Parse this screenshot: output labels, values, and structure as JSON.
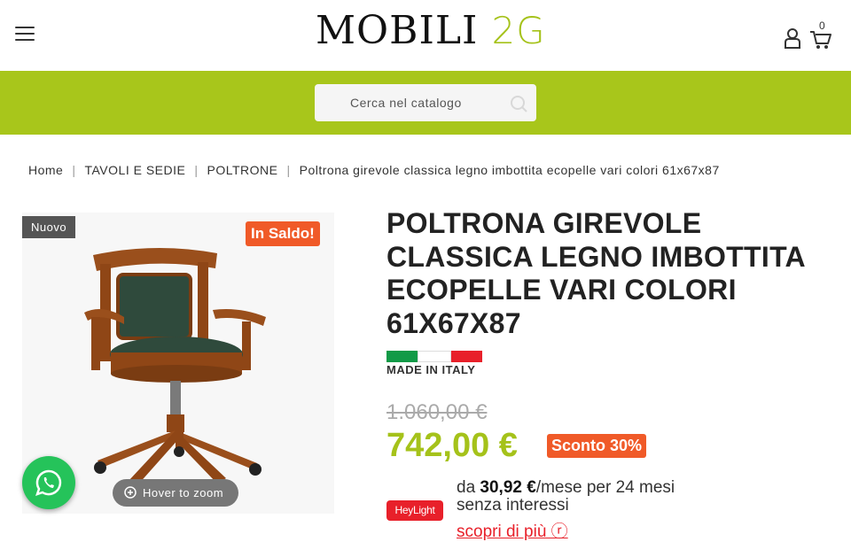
{
  "header": {
    "logo_text_1": "MOBILI ",
    "logo_text_2": "2G",
    "cart_count": "0",
    "icons": [
      "menu-icon",
      "user-icon",
      "cart-icon"
    ]
  },
  "search": {
    "placeholder": "Cerca nel catalogo"
  },
  "breadcrumb": {
    "items": [
      "Home",
      "TAVOLI E SEDIE",
      "POLTRONE",
      "Poltrona girevole classica legno imbottita ecopelle vari colori 61x67x87"
    ],
    "separator": "|"
  },
  "gallery": {
    "badge_new": "Nuovo",
    "badge_sale": "In Saldo!",
    "zoom_label": "Hover to zoom"
  },
  "product": {
    "title": "Poltrona girevole classica legno imbottita ecopelle vari colori 61x67x87",
    "made_in": "MADE IN ITALY",
    "old_price": "1.060,00 €",
    "price": "742,00 €",
    "discount": "Sconto 30%"
  },
  "financing": {
    "provider": "HeyLight",
    "prefix": "da ",
    "amount": "30,92 €",
    "suffix": "/mese per 24 mesi senza interessi",
    "discover": "scopri di più ⓡ"
  },
  "colors": {
    "brand_green": "#a8c61b",
    "sale_orange": "#f05a28",
    "heylight_red": "#e8202a",
    "whatsapp_green": "#25c35a"
  }
}
